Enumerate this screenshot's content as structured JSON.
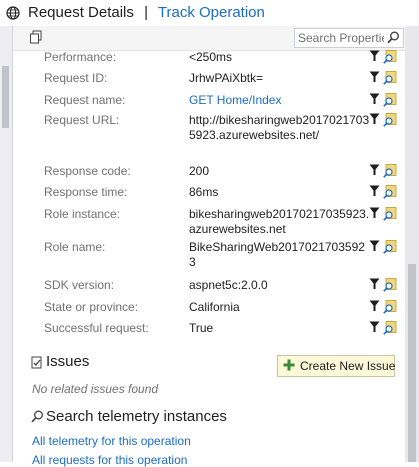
{
  "header": {
    "title": "Request Details",
    "separator": "|",
    "link": "Track Operation"
  },
  "toolbar": {
    "search_placeholder": "Search Properties"
  },
  "properties": [
    {
      "label": "Performance:",
      "value": "<250ms"
    },
    {
      "label": "Request ID:",
      "value": "JrhwPAiXbtk="
    },
    {
      "label": "Request name:",
      "value": "GET Home/Index"
    },
    {
      "label": "Request URL:",
      "value": "http://bikesharingweb20170217035923.azurewebsites.net/"
    },
    {
      "label": "Response code:",
      "value": "200"
    },
    {
      "label": "Response time:",
      "value": "86ms"
    },
    {
      "label": "Role instance:",
      "value": "bikesharingweb20170217035923.azurewebsites.net"
    },
    {
      "label": "Role name:",
      "value": "BikeSharingWeb20170217035923"
    },
    {
      "label": "SDK version:",
      "value": "aspnet5c:2.0.0"
    },
    {
      "label": "State or province:",
      "value": "California"
    },
    {
      "label": "Successful request:",
      "value": "True"
    }
  ],
  "issues": {
    "heading": "Issues",
    "create_button": "Create New Issue",
    "empty_text": "No related issues found"
  },
  "search": {
    "heading": "Search telemetry instances",
    "links": [
      "All telemetry for this operation",
      "All requests for this operation"
    ]
  },
  "colors": {
    "link": "#1c6cc4",
    "label": "#717171",
    "button_bg": "#fcf8d8",
    "scrollbar": "#c2c3c9"
  }
}
